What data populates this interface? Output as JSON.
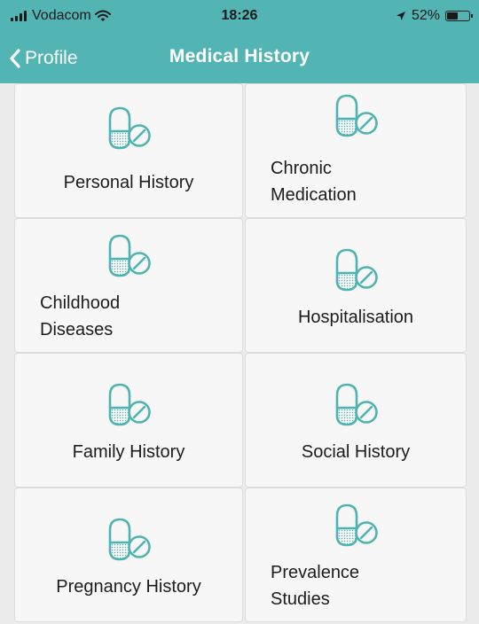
{
  "status_bar": {
    "carrier": "Vodacom",
    "time": "18:26",
    "battery": "52%",
    "battery_level": 0.52,
    "wifi_icon": "wifi-icon",
    "location_icon": "location-arrow-icon"
  },
  "nav": {
    "back_label": "Profile",
    "title": "Medical History"
  },
  "tiles": [
    {
      "label": "Personal History",
      "icon": "pill-icon"
    },
    {
      "label": "Chronic Medication",
      "icon": "pill-icon"
    },
    {
      "label": "Childhood Diseases",
      "icon": "pill-icon"
    },
    {
      "label": "Hospitalisation",
      "icon": "pill-icon"
    },
    {
      "label": "Family History",
      "icon": "pill-icon"
    },
    {
      "label": "Social History",
      "icon": "pill-icon"
    },
    {
      "label": "Pregnancy History",
      "icon": "pill-icon"
    },
    {
      "label": "Prevalence Studies",
      "icon": "pill-icon"
    }
  ],
  "colors": {
    "accent": "#52b5b3",
    "icon": "#4fb3b1",
    "tile_bg": "#f7f7f7",
    "page_bg": "#ececec"
  }
}
